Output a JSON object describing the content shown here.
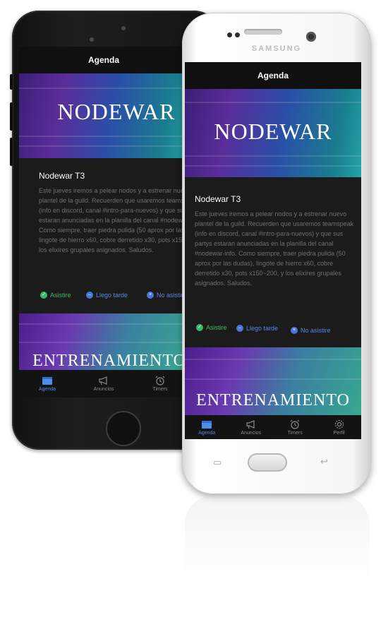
{
  "iphone": {
    "header_title": "Agenda",
    "banner_title": "NODEWAR",
    "event_title": "Nodewar T3",
    "event_description": "Este jueves iremos a pelear nodos y a estrenar nuevo plantel de la guild. Recuerden que usaremos teamspeak (info en discord, canal #intro-para-nuevos) y que sus partys estaran anunciadas en la planilla del canal #nodewar-info. Como siempre, traer piedra pulida (50 aprox por las dudas), lingote de hierro x60, cobre derretido x30, pots x150~200, y los elixires grupales asignados. Saludos.",
    "rsvp": {
      "attend": "Asistire",
      "late": "Llego tarde",
      "decline": "No asistire"
    },
    "banner2_title": "ENTRENAMIENTO",
    "tabs": [
      "Agenda",
      "Anuncios",
      "Timers"
    ]
  },
  "samsung": {
    "brand": "SAMSUNG",
    "header_title": "Agenda",
    "banner_title": "NODEWAR",
    "event_title": "Nodewar T3",
    "event_description": "Este jueves iremos a pelear nodos y a estrenar nuevo plantel de la guild. Recuerden que usaremos teamspeak (info en discord, canal #intro-para-nuevos) y que sus partys estaran anunciadas en la planilla del canal #nodewar-info. Como siempre, traer piedra pulida (50 aprox por las dudas), lingote de hierro x60, cobre derretido x30, pots x150~200, y los elixires grupales asignados. Saludos.",
    "rsvp": {
      "attend": "Asistire",
      "late": "Llego tarde",
      "decline": "No asistire"
    },
    "banner2_title": "ENTRENAMIENTO",
    "tabs": [
      "Agenda",
      "Anuncios",
      "Timers",
      "Perfil"
    ]
  },
  "colors": {
    "active_tab": "#4d8fe8",
    "attend": "#3db86a",
    "late": "#5a86e6",
    "screen_bg": "#1b1b1b"
  },
  "icons": {
    "tab_agenda": "calendar-icon",
    "tab_anuncios": "megaphone-icon",
    "tab_timers": "alarm-clock-icon",
    "tab_perfil": "gear-icon"
  }
}
